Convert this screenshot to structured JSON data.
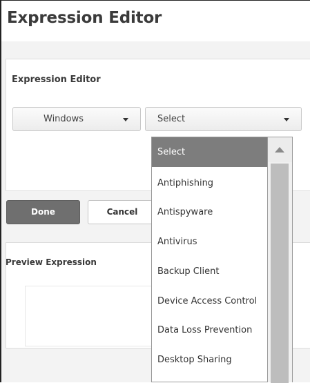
{
  "header": {
    "title": "Expression Editor"
  },
  "editor": {
    "heading": "Expression Editor",
    "os_dropdown": {
      "selected": "Windows"
    },
    "category_dropdown": {
      "selected": "Select",
      "options": [
        "Select",
        "Antiphishing",
        "Antispyware",
        "Antivirus",
        "Backup Client",
        "Device Access Control",
        "Data Loss Prevention",
        "Desktop Sharing"
      ],
      "highlighted_index": 0
    }
  },
  "actions": {
    "done_label": "Done",
    "cancel_label": "Cancel"
  },
  "preview": {
    "heading": "Preview Expression"
  },
  "colors": {
    "primary_button": "#6f6f6f",
    "selected_option": "#7d7d7d",
    "background": "#f3f3f3"
  },
  "icons": {
    "dropdown": "chevron-down-icon",
    "scroll_up": "scroll-up-arrow-icon"
  }
}
